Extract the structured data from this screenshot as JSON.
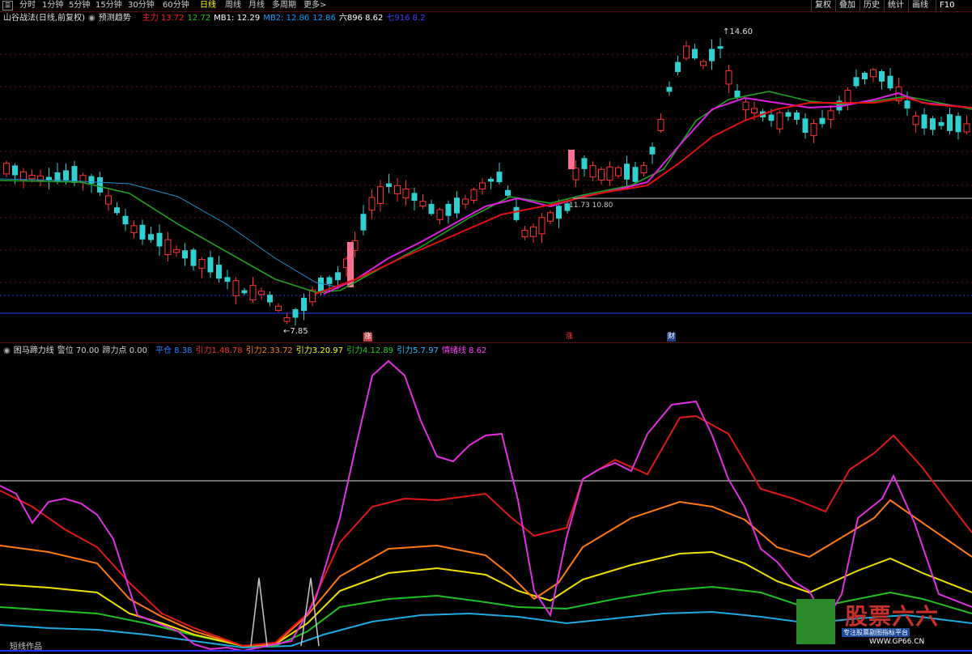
{
  "toolbar": {
    "icon": "menu-icon",
    "periods": [
      "分时",
      "1分钟",
      "5分钟",
      "15分钟",
      "30分钟",
      "60分钟",
      "日线",
      "周线",
      "月线",
      "多周期",
      "更多>"
    ],
    "active_period": "日线",
    "right_buttons": [
      "复权",
      "叠加",
      "历史",
      "统计",
      "画线",
      "F10"
    ]
  },
  "top_legend": {
    "title": "山谷战法(日线,前复权)",
    "signal": "预测趋势",
    "items": [
      {
        "text": "主力 13.72",
        "color": "#ff2020"
      },
      {
        "text": "12.72",
        "color": "#20c020"
      },
      {
        "text": "MB1: 12.29",
        "color": "#ffffff"
      },
      {
        "text": "MB2: 12.86",
        "color": "#00a0ff"
      },
      {
        "text": "12.86",
        "color": "#00a0ff"
      },
      {
        "text": "六896 8.62",
        "color": "#ffffff"
      },
      {
        "text": "七916 8.2",
        "color": "#4040ff"
      }
    ]
  },
  "price_annotations": {
    "high": "14.60",
    "low": "7.85",
    "mid": "11.73 10.80"
  },
  "markers": [
    "涨",
    "涨",
    "财"
  ],
  "bottom_legend": {
    "title": "困马蹄力线",
    "items": [
      {
        "text": "警位 70.00",
        "color": "#d0d0d0"
      },
      {
        "text": "蹄力点 0.00",
        "color": "#d0d0d0"
      },
      {
        "text": "平仓 8.38",
        "color": "#3080ff"
      },
      {
        "text": "引力1.48.78",
        "color": "#ff3030"
      },
      {
        "text": "引力2.33.72",
        "color": "#ff8020"
      },
      {
        "text": "引力3.20.97",
        "color": "#ffff00"
      },
      {
        "text": "引力4.12.89",
        "color": "#20d020"
      },
      {
        "text": "引力5.7.97",
        "color": "#20c0ff"
      },
      {
        "text": "情绪线 8.62",
        "color": "#ff40ff"
      }
    ]
  },
  "footer": "短线作品",
  "watermark": {
    "title": "股票六六",
    "subtitle": "专注股票副图指标平台",
    "url": "WWW.GP66.CN"
  }
}
